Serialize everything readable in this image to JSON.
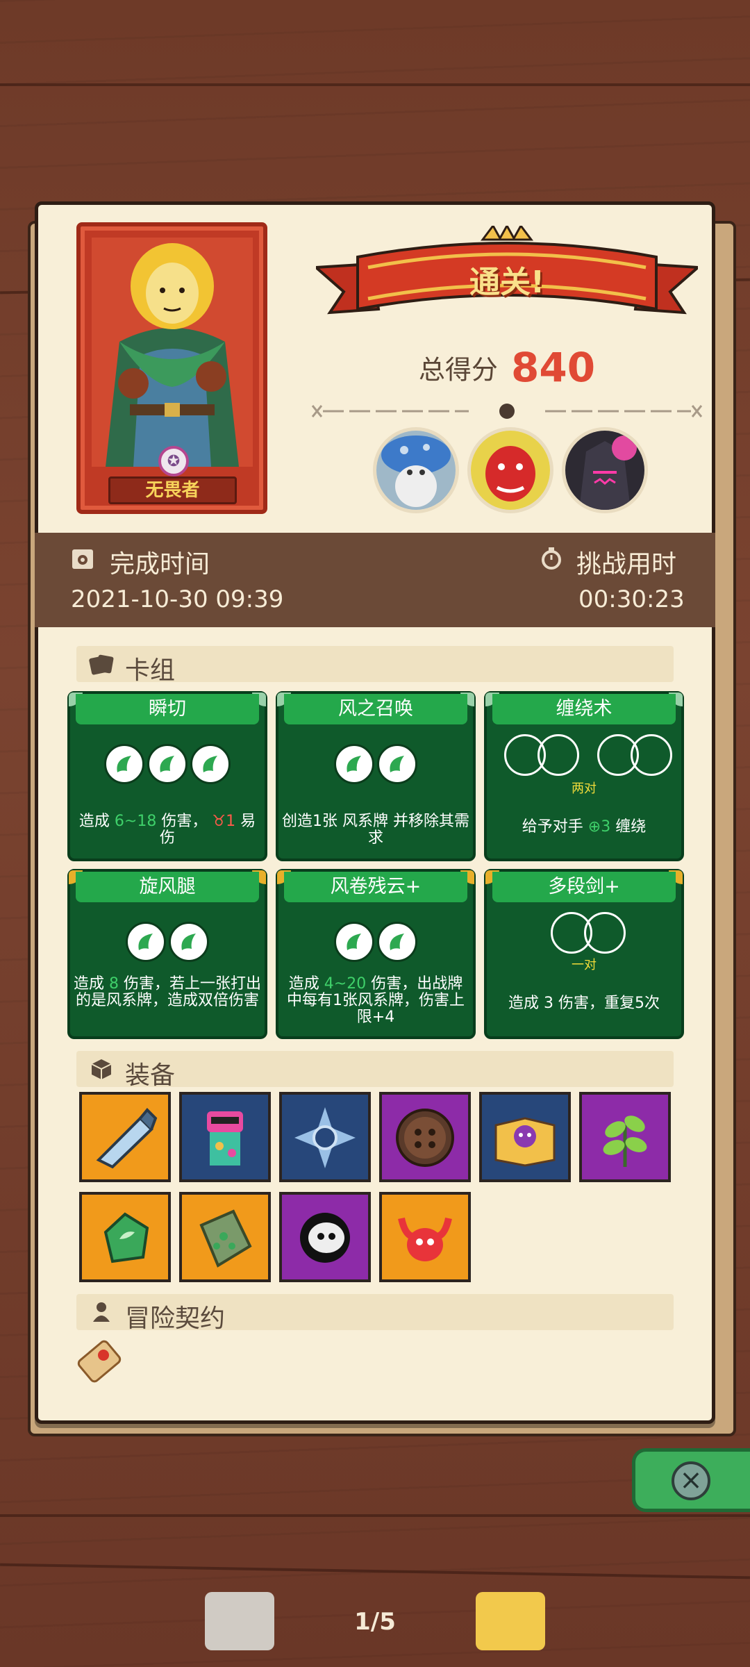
{
  "hero": {
    "name": "无畏者"
  },
  "result": {
    "banner": "通关!",
    "score_label": "总得分",
    "score": "840"
  },
  "times": {
    "complete_label": "完成时间",
    "complete_value": "2021-10-30 09:39",
    "duration_label": "挑战用时",
    "duration_value": "00:30:23"
  },
  "deck": {
    "title": "卡组",
    "cards": [
      {
        "name": "瞬切",
        "desc_pre": "造成",
        "desc_val": "6~18",
        "desc_mid": "伤害，",
        "desc_val2": "1",
        "desc_post": "易伤"
      },
      {
        "name": "风之召唤",
        "desc": "创造1张 风系牌 并移除其需求"
      },
      {
        "name": "缠绕术",
        "pair": "两对",
        "desc_pre": "给予对手",
        "desc_val": "3",
        "desc_post": "缠绕"
      },
      {
        "name": "旋风腿",
        "desc_pre": "造成",
        "desc_val": "8",
        "desc_post": "伤害，若上一张打出的是风系牌，造成双倍伤害"
      },
      {
        "name": "风卷残云+",
        "desc_pre": "造成",
        "desc_val": "4~20",
        "desc_post": "伤害，出战牌中每有1张风系牌，伤害上限+4"
      },
      {
        "name": "多段剑+",
        "pair": "一对",
        "desc": "造成 3 伤害，重复5次"
      }
    ]
  },
  "equipment": {
    "title": "装备"
  },
  "contract": {
    "title": "冒险契约"
  },
  "nav": {
    "page": "1/5",
    "close": "×"
  }
}
